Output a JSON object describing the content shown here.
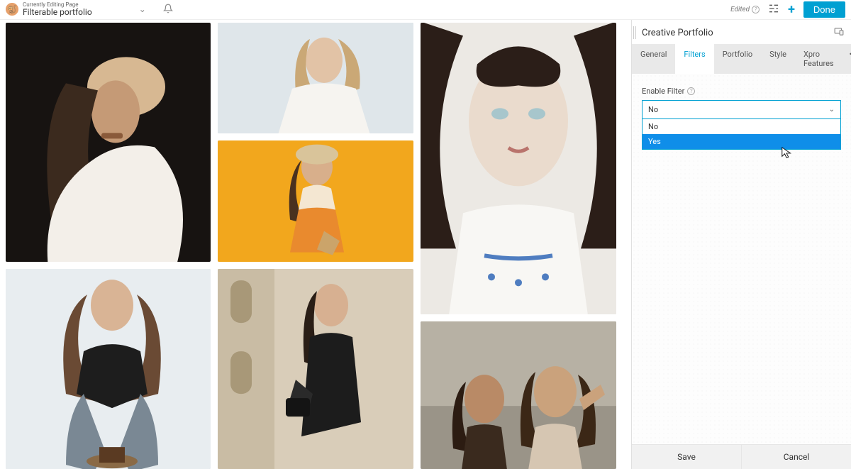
{
  "topbar": {
    "editing_label": "Currently Editing Page",
    "page_title": "Filterable portfolio",
    "edited_label": "Edited",
    "done_label": "Done"
  },
  "panel": {
    "title": "Creative Portfolio",
    "tabs": {
      "general": "General",
      "filters": "Filters",
      "portfolio": "Portfolio",
      "style": "Style",
      "xpro": "Xpro Features",
      "more": "•••"
    },
    "enable_filter_label": "Enable Filter",
    "enable_filter_value": "No",
    "enable_filter_options": {
      "no": "No",
      "yes": "Yes"
    },
    "save_label": "Save",
    "cancel_label": "Cancel"
  }
}
